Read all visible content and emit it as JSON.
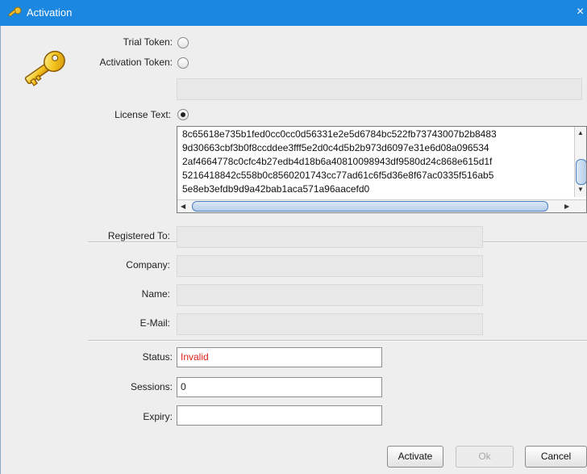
{
  "window": {
    "title": "Activation",
    "close_icon": "×"
  },
  "token": {
    "trial_label": "Trial Token:",
    "activation_label": "Activation Token:",
    "activation_value": "",
    "license_label": "License Text:",
    "selected": "license"
  },
  "license": {
    "lines": [
      "8c65618e735b1fed0cc0cc0d56331e2e5d6784bc522fb73743007b2b8483",
      "9d30663cbf3b0f8ccddee3fff5e2d0c4d5b2b973d6097e31e6d08a096534",
      "2af4664778c0cfc4b27edb4d18b6a40810098943df9580d24c868e615d1f",
      "5216418842c558b0c8560201743cc77ad61c6f5d36e8f67ac0335f516ab5",
      "5e8eb3efdb9d9a42bab1aca571a96aacefd0"
    ]
  },
  "registration": {
    "registered_to_label": "Registered To:",
    "registered_to_value": "",
    "company_label": "Company:",
    "company_value": "",
    "name_label": "Name:",
    "name_value": "",
    "email_label": "E-Mail:",
    "email_value": ""
  },
  "status": {
    "status_label": "Status:",
    "status_value": "Invalid",
    "sessions_label": "Sessions:",
    "sessions_value": "0",
    "expiry_label": "Expiry:",
    "expiry_value": ""
  },
  "buttons": {
    "activate": "Activate",
    "ok": "Ok",
    "cancel": "Cancel"
  },
  "colors": {
    "titlebar": "#1c87e0",
    "status_invalid": "#e0201a"
  }
}
